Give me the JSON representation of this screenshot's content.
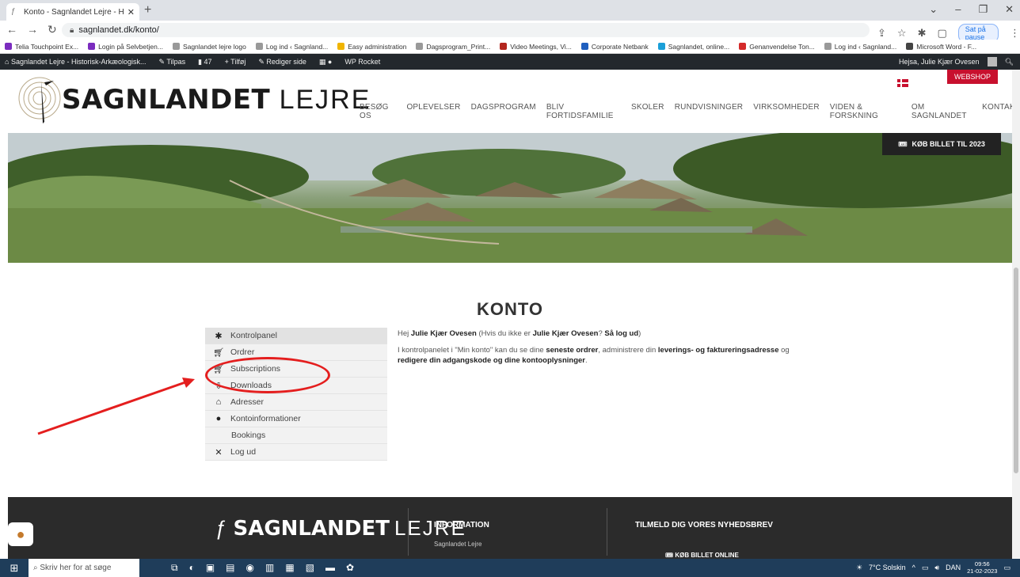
{
  "browser": {
    "tab_title": "Konto - Sagnlandet Lejre - Histor",
    "url": "sagnlandet.dk/konto/",
    "pause_label": "Sat på pause",
    "bookmarks": [
      {
        "label": "Telia Touchpoint Ex...",
        "color": "#7b2cbf"
      },
      {
        "label": "Login på Selvbetjen...",
        "color": "#7b2cbf"
      },
      {
        "label": "Sagnlandet lejre logo",
        "color": "#999999"
      },
      {
        "label": "Log ind ‹ Sagnland...",
        "color": "#999999"
      },
      {
        "label": "Easy administration",
        "color": "#f0b400"
      },
      {
        "label": "Dagsprogram_Print...",
        "color": "#999999"
      },
      {
        "label": "Video Meetings, Vi...",
        "color": "#b3261e"
      },
      {
        "label": "Corporate Netbank",
        "color": "#1f5fbf"
      },
      {
        "label": "Sagnlandet, online...",
        "color": "#1a9fd8"
      },
      {
        "label": "Genanvendelse Ton...",
        "color": "#d42a2a"
      },
      {
        "label": "Log ind ‹ Sagnland...",
        "color": "#999999"
      },
      {
        "label": "Microsoft Word - F...",
        "color": "#444444"
      }
    ]
  },
  "wpbar": {
    "site": "Sagnlandet Lejre - Historisk-Arkæologisk...",
    "customize": "Tilpas",
    "comments": "47",
    "add": "Tilføj",
    "edit": "Rediger side",
    "rocket": "WP Rocket",
    "greeting": "Hejsa, Julie Kjær Ovesen"
  },
  "header": {
    "logo_bold": "SAGNLANDET",
    "logo_light": "LEJRE",
    "webshop": "WEBSHOP",
    "nav": [
      "BESØG OS",
      "OPLEVELSER",
      "DAGSPROGRAM",
      "BLIV FORTIDSFAMILIE",
      "SKOLER",
      "RUNDVISNINGER",
      "VIRKSOMHEDER",
      "VIDEN & FORSKNING",
      "OM SAGNLANDET",
      "KONTAKT"
    ]
  },
  "hero": {
    "ticket_label": "KØB BILLET TIL 2023"
  },
  "page": {
    "title": "KONTO"
  },
  "account_menu": [
    {
      "label": "Kontrolpanel",
      "icon": "gear-icon"
    },
    {
      "label": "Ordrer",
      "icon": "cart-icon"
    },
    {
      "label": "Subscriptions",
      "icon": "cart-icon"
    },
    {
      "label": "Downloads",
      "icon": "download-icon"
    },
    {
      "label": "Adresser",
      "icon": "home-icon"
    },
    {
      "label": "Kontoinformationer",
      "icon": "user-icon"
    },
    {
      "label": "Bookings",
      "icon": ""
    },
    {
      "label": "Log ud",
      "icon": "close-icon"
    }
  ],
  "greeting": {
    "hello": "Hej",
    "name": "Julie Kjær Ovesen",
    "paren_open": "(Hvis du ikke er",
    "name2": "Julie Kjær Ovesen",
    "logout": "Så log ud",
    "p2_a": "I kontrolpanelet i \"Min konto\" kan du se dine",
    "p2_b": "seneste ordrer",
    "p2_c": ", administrere din",
    "p2_d": "leverings- og faktureringsadresse",
    "p2_e": "og",
    "p2_f": "redigere din adgangskode og dine kontooplysninger",
    "p2_g": "."
  },
  "footer": {
    "logo_bold": "SAGNLANDET",
    "logo_light": "LEJRE",
    "info_heading": "INFORMATION",
    "info_item": "Sagnlandet Lejre",
    "newsletter": "TILMELD DIG VORES NYHEDSBREV",
    "buy_online": "KØB BILLET ONLINE"
  },
  "taskbar": {
    "search_placeholder": "Skriv her for at søge",
    "weather": "7°C  Solskin",
    "lang": "DAN",
    "time": "09:56",
    "date": "21-02-2023"
  },
  "colors": {
    "brand_red": "#c8102e",
    "annotation_red": "#e41e1e"
  }
}
